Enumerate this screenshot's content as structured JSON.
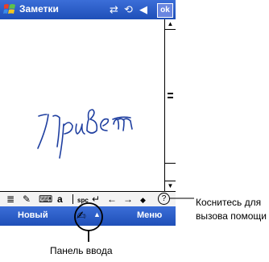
{
  "title_bar": {
    "app_title": "Заметки",
    "ok_label": "ok",
    "icons": [
      "connectivity-icon",
      "sync-icon",
      "volume-icon"
    ]
  },
  "note": {
    "handwritten_text": "Привет"
  },
  "input_toolbar": {
    "tools": [
      {
        "name": "list-icon",
        "glyph": "≣"
      },
      {
        "name": "handwriting-icon",
        "glyph": "✎"
      },
      {
        "name": "keyboard-icon",
        "glyph": "⌨"
      },
      {
        "name": "font-a-icon",
        "glyph": "a"
      },
      {
        "name": "space-label",
        "glyph": "spc"
      },
      {
        "name": "enter-icon",
        "glyph": "↵"
      },
      {
        "name": "left-arrow-icon",
        "glyph": "←"
      },
      {
        "name": "right-arrow-icon",
        "glyph": "→"
      },
      {
        "name": "backspace-icon",
        "glyph": "◆"
      },
      {
        "name": "help-icon",
        "glyph": "?"
      }
    ]
  },
  "menu_bar": {
    "new_label": "Новый",
    "menu_label": "Меню",
    "sip_arrow": "▲"
  },
  "callouts": {
    "help_label_line1": "Коснитесь для",
    "help_label_line2": "вызова помощи",
    "input_panel_label": "Панель ввода"
  },
  "colors": {
    "title_bar": "#2a5fcc",
    "toolbar_bg": "#f3f3f3",
    "ink": "#1f3fa0"
  }
}
